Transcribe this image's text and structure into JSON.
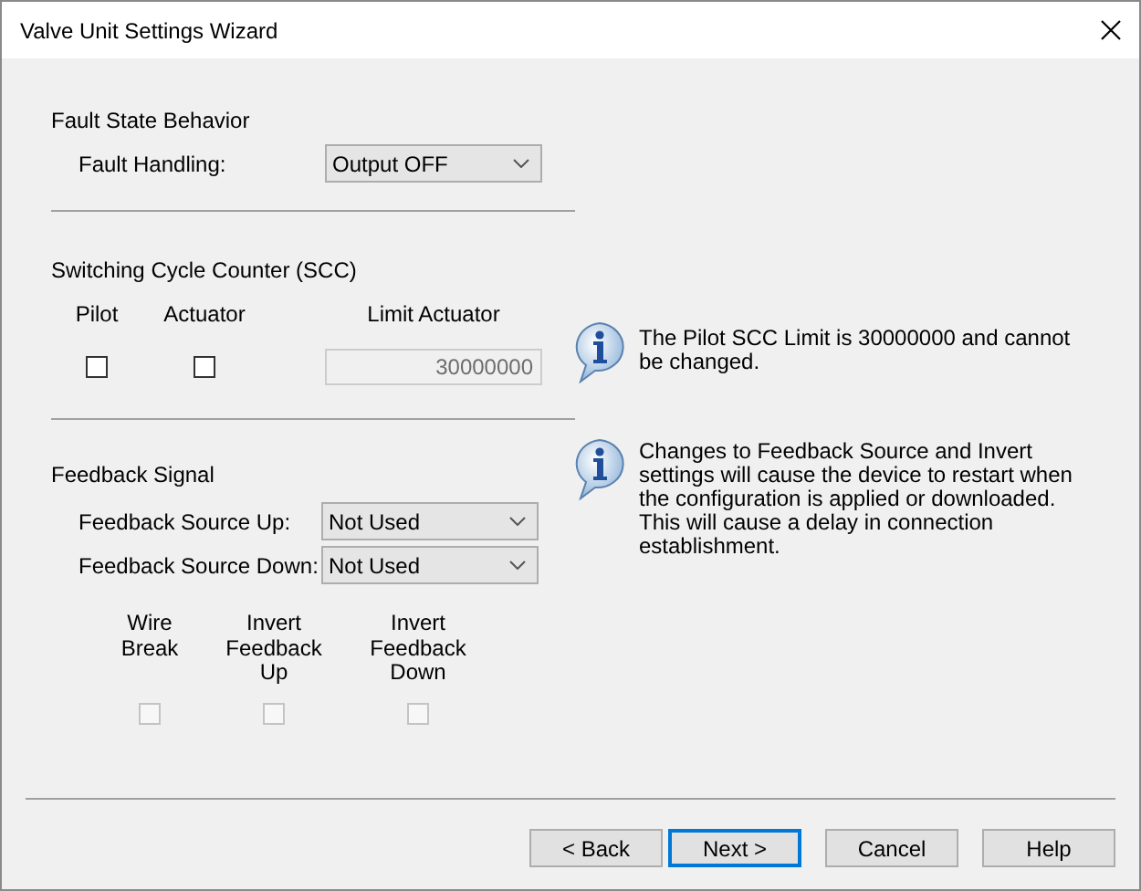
{
  "window": {
    "title": "Valve Unit Settings Wizard"
  },
  "fault_state": {
    "heading": "Fault State Behavior",
    "label": "Fault Handling:",
    "value": "Output OFF"
  },
  "scc": {
    "heading": "Switching Cycle Counter (SCC)",
    "checkboxes": [
      {
        "label": "Pilot",
        "checked": false,
        "disabled": false
      },
      {
        "label": "Actuator",
        "checked": false,
        "disabled": false
      }
    ],
    "limit": {
      "label": "Limit Actuator",
      "value": "30000000",
      "disabled": true
    }
  },
  "feedback": {
    "heading": "Feedback Signal",
    "dropdowns": [
      {
        "label": "Feedback Source Up:",
        "value": "Not Used"
      },
      {
        "label": "Feedback Source Down:",
        "value": "Not Used"
      }
    ],
    "checkboxes": [
      {
        "label": "Wire Break",
        "checked": false,
        "disabled": true
      },
      {
        "label": "Invert Feedback Up",
        "checked": false,
        "disabled": true
      },
      {
        "label": "Invert Feedback Down",
        "checked": false,
        "disabled": true
      }
    ]
  },
  "info": [
    "The Pilot SCC Limit is 30000000 and cannot be changed.",
    "Changes to Feedback Source and Invert settings will cause the device to restart when the configuration is applied or downloaded.\nThis will cause a delay in connection establishment."
  ],
  "buttons": [
    {
      "label": "< Back",
      "default": false
    },
    {
      "label": "Next >",
      "default": true
    },
    {
      "label": "Cancel",
      "default": false
    },
    {
      "label": "Help",
      "default": false
    }
  ]
}
